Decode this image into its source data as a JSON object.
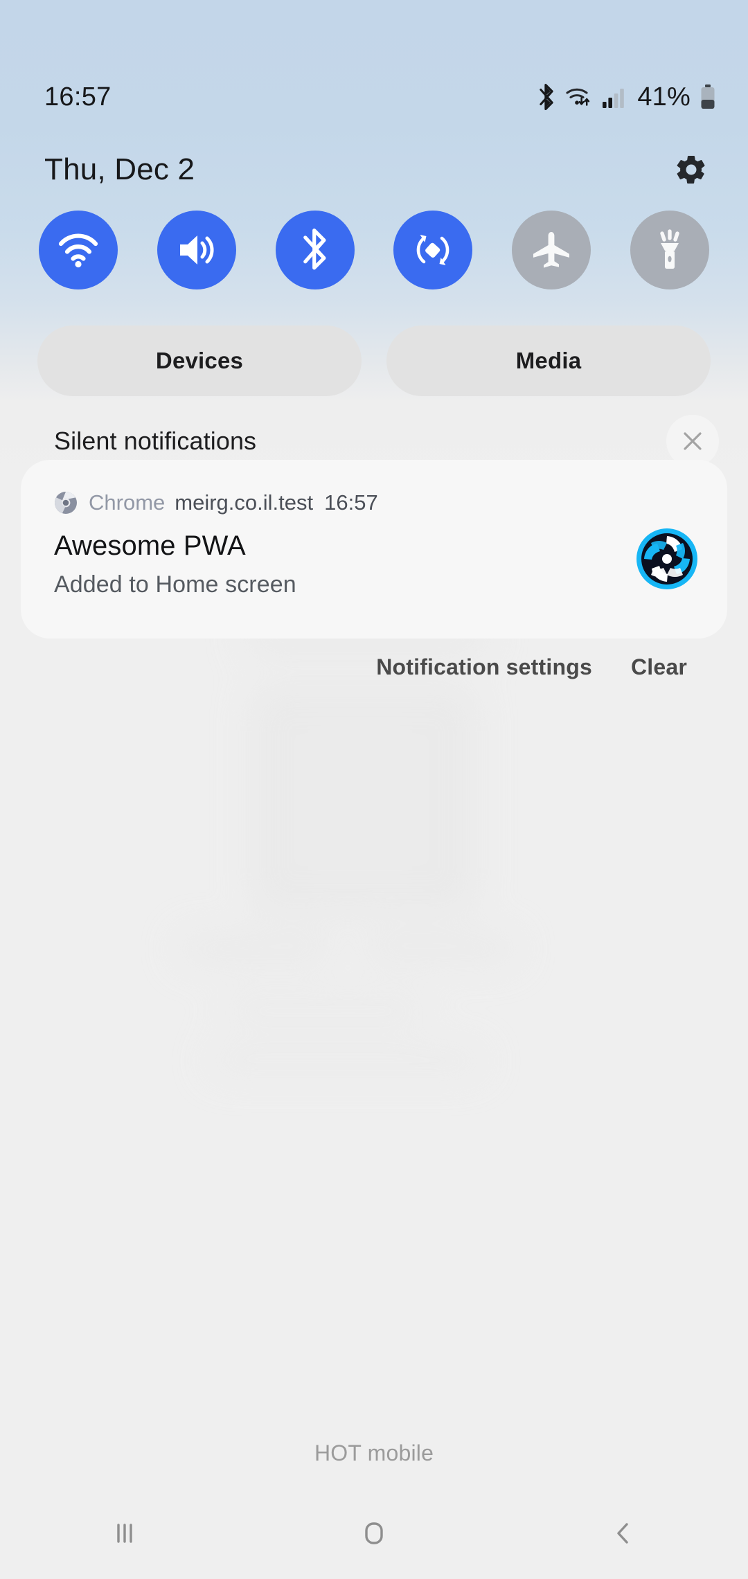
{
  "status_bar": {
    "clock": "16:57",
    "battery_percent": "41%",
    "icons": [
      "bluetooth-icon",
      "wifi-icon",
      "cellular-signal-icon",
      "battery-icon"
    ],
    "signal_bars_filled": 2,
    "signal_bars_total": 4,
    "battery_level_fraction": 0.41
  },
  "header": {
    "date": "Thu, Dec 2",
    "settings_icon": "gear-icon"
  },
  "quick_settings": {
    "toggles": [
      {
        "name": "wifi",
        "label": "Wi-Fi",
        "icon": "wifi-icon",
        "state": "on"
      },
      {
        "name": "sound",
        "label": "Sound",
        "icon": "volume-icon",
        "state": "on"
      },
      {
        "name": "bluetooth",
        "label": "Bluetooth",
        "icon": "bluetooth-icon",
        "state": "on"
      },
      {
        "name": "auto-rotate",
        "label": "Auto rotate",
        "icon": "auto-rotate-icon",
        "state": "on"
      },
      {
        "name": "airplane-mode",
        "label": "Airplane mode",
        "icon": "airplane-icon",
        "state": "off"
      },
      {
        "name": "flashlight",
        "label": "Flashlight",
        "icon": "flashlight-icon",
        "state": "off"
      }
    ],
    "on_color": "#3a6bf0",
    "off_color": "#a9aeb6"
  },
  "shortcuts": {
    "devices_label": "Devices",
    "media_label": "Media"
  },
  "notification_section": {
    "title": "Silent notifications",
    "close_icon": "close-icon"
  },
  "notification": {
    "app_icon": "chrome-icon",
    "app_name": "Chrome",
    "source": "meirg.co.il.test",
    "time": "16:57",
    "title": "Awesome PWA",
    "text": "Added to Home screen",
    "badge_icon": "pwa-app-icon",
    "badge_ring_color": "#17b6f5",
    "badge_bg_color": "#0b1020"
  },
  "notification_actions": {
    "settings_label": "Notification settings",
    "clear_label": "Clear"
  },
  "footer": {
    "carrier": "HOT mobile"
  },
  "nav_bar": {
    "recents_icon": "recents-icon",
    "home_icon": "home-icon",
    "back_icon": "back-icon"
  }
}
